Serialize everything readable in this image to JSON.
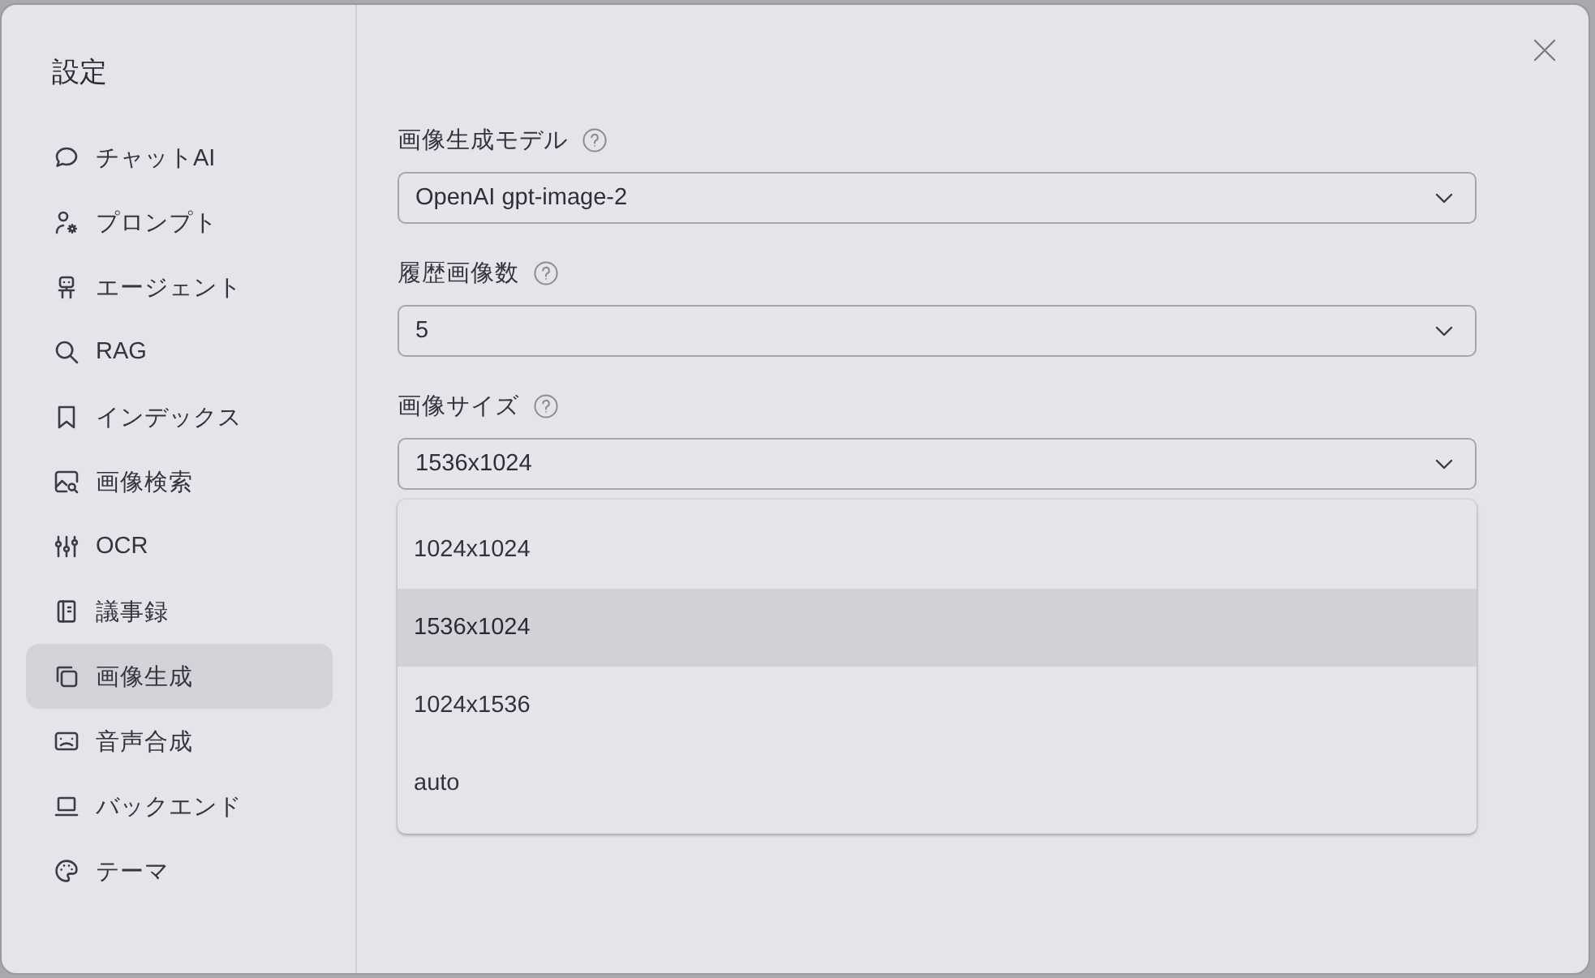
{
  "dialog": {
    "title": "設定"
  },
  "sidebar": {
    "items": [
      {
        "label": "チャットAI",
        "selected": false
      },
      {
        "label": "プロンプト",
        "selected": false
      },
      {
        "label": "エージェント",
        "selected": false
      },
      {
        "label": "RAG",
        "selected": false
      },
      {
        "label": "インデックス",
        "selected": false
      },
      {
        "label": "画像検索",
        "selected": false
      },
      {
        "label": "OCR",
        "selected": false
      },
      {
        "label": "議事録",
        "selected": false
      },
      {
        "label": "画像生成",
        "selected": true
      },
      {
        "label": "音声合成",
        "selected": false
      },
      {
        "label": "バックエンド",
        "selected": false
      },
      {
        "label": "テーマ",
        "selected": false
      }
    ]
  },
  "fields": [
    {
      "label": "画像生成モデル",
      "value": "OpenAI gpt-image-2"
    },
    {
      "label": "履歴画像数",
      "value": "5"
    },
    {
      "label": "画像サイズ",
      "value": "1536x1024",
      "options": [
        {
          "label": "1024x1024",
          "selected": false
        },
        {
          "label": "1536x1024",
          "selected": true
        },
        {
          "label": "1024x1536",
          "selected": false
        },
        {
          "label": "auto",
          "selected": false
        }
      ]
    }
  ]
}
